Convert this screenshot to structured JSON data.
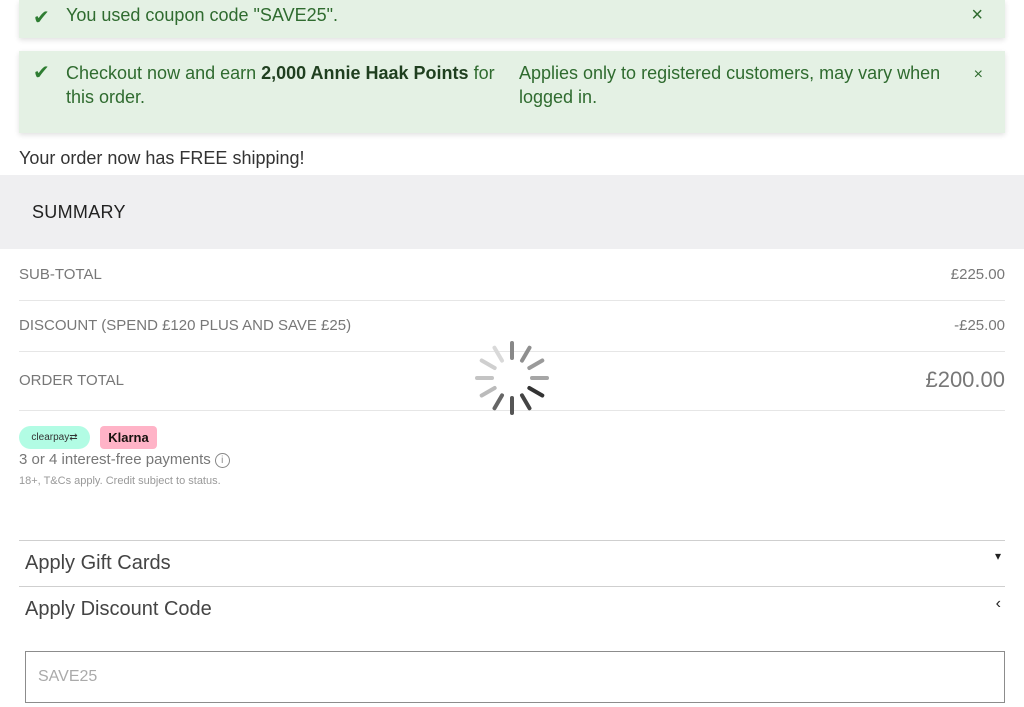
{
  "notices": {
    "coupon": {
      "message": "You used coupon code \"SAVE25\".",
      "close_icon": "×"
    },
    "points": {
      "message_before": "Checkout now and earn ",
      "points_bold": "2,000 Annie Haak Points",
      "message_after": " for this order.",
      "note": "Applies only to registered customers, may vary when logged in.",
      "close_icon": "×"
    },
    "check_icon": "✔"
  },
  "free_shipping": "Your order now has FREE shipping!",
  "summary": {
    "header": "SUMMARY",
    "rows": [
      {
        "label": "SUB-TOTAL",
        "value": "£225.00"
      },
      {
        "label": "DISCOUNT (SPEND £120 PLUS AND SAVE £25)",
        "value": "-£25.00"
      },
      {
        "label": "ORDER TOTAL",
        "value": "£200.00"
      }
    ]
  },
  "bnpl": {
    "clearpay": "clearpay⇄",
    "klarna": "Klarna",
    "text": "3 or 4 interest-free payments",
    "info_icon": "i",
    "fine_print": "18+, T&Cs apply. Credit subject to status."
  },
  "accordions": [
    {
      "label": "Apply Gift Cards",
      "icon": "▾"
    },
    {
      "label": "Apply Discount Code",
      "icon": "‹"
    }
  ],
  "discount_input": {
    "placeholder": "SAVE25"
  },
  "colors": {
    "notice_bg": "#e4f1e4",
    "notice_text": "#2f6b2f",
    "summary_bg": "#efeff1",
    "clearpay": "#b2fce4",
    "klarna": "#ffb3c7"
  }
}
